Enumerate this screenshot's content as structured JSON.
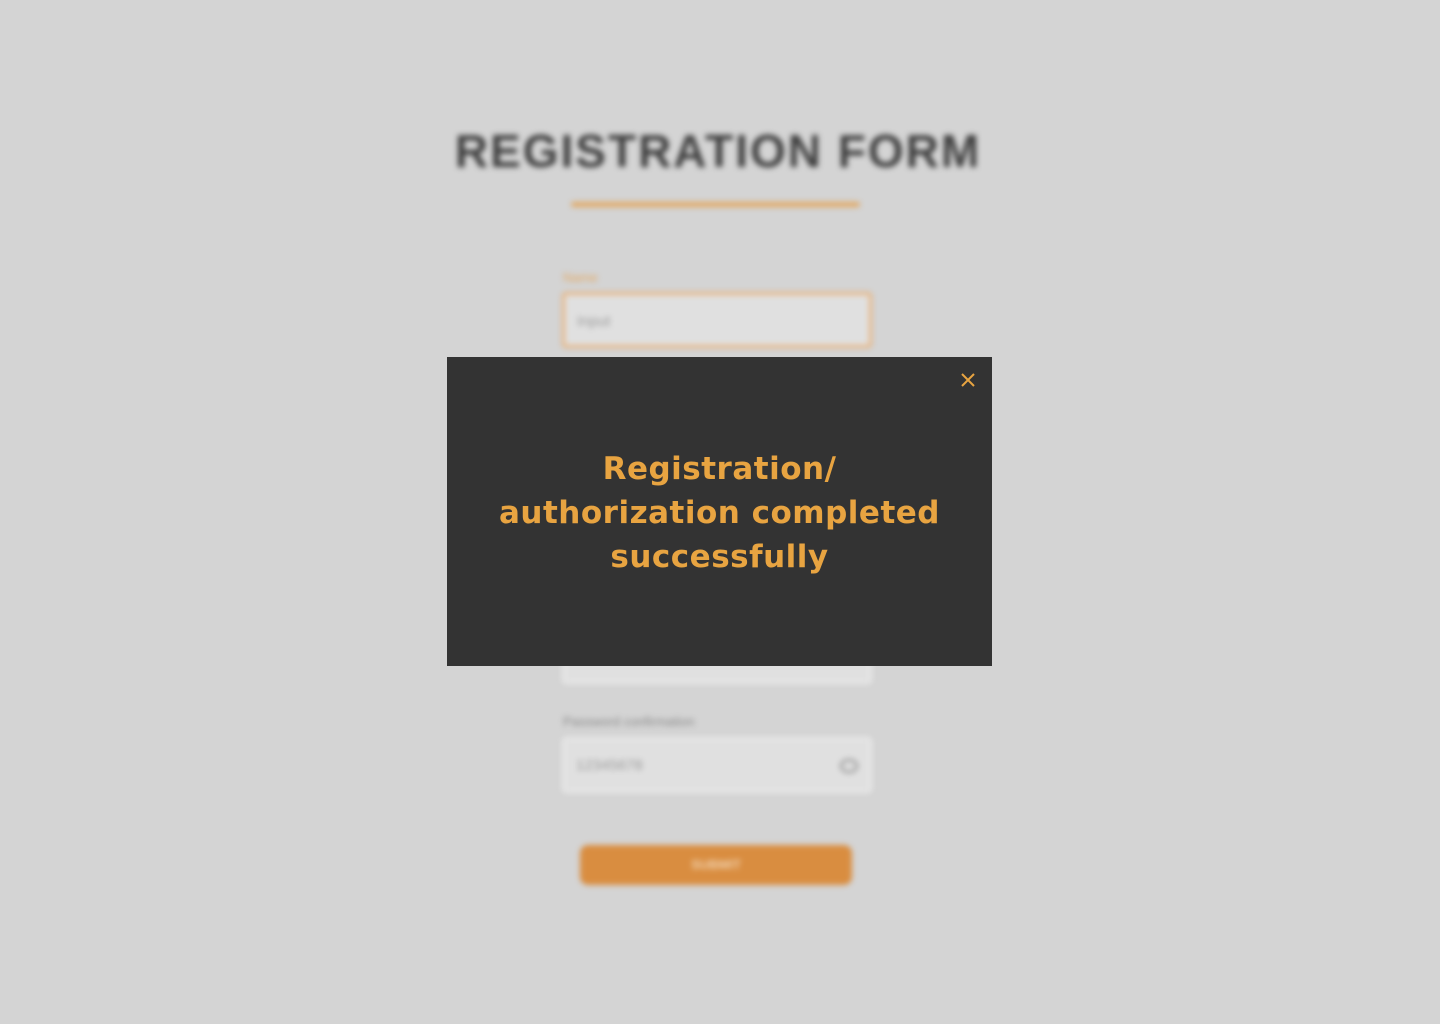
{
  "background_form": {
    "title": "REGISTRATION FORM",
    "fields": [
      {
        "label": "Name",
        "value": "Input"
      },
      {
        "label": "",
        "value": ""
      },
      {
        "label": "Password confirmation",
        "value": "12345678"
      }
    ],
    "submit_label": "SUBMIT"
  },
  "modal": {
    "message": "Registration/ authorization completed successfully",
    "close_icon": "close-icon"
  },
  "colors": {
    "page_background": "#d4d4d4",
    "modal_background": "#333333",
    "accent": "#e8a441",
    "submit_button": "#d98d40"
  }
}
